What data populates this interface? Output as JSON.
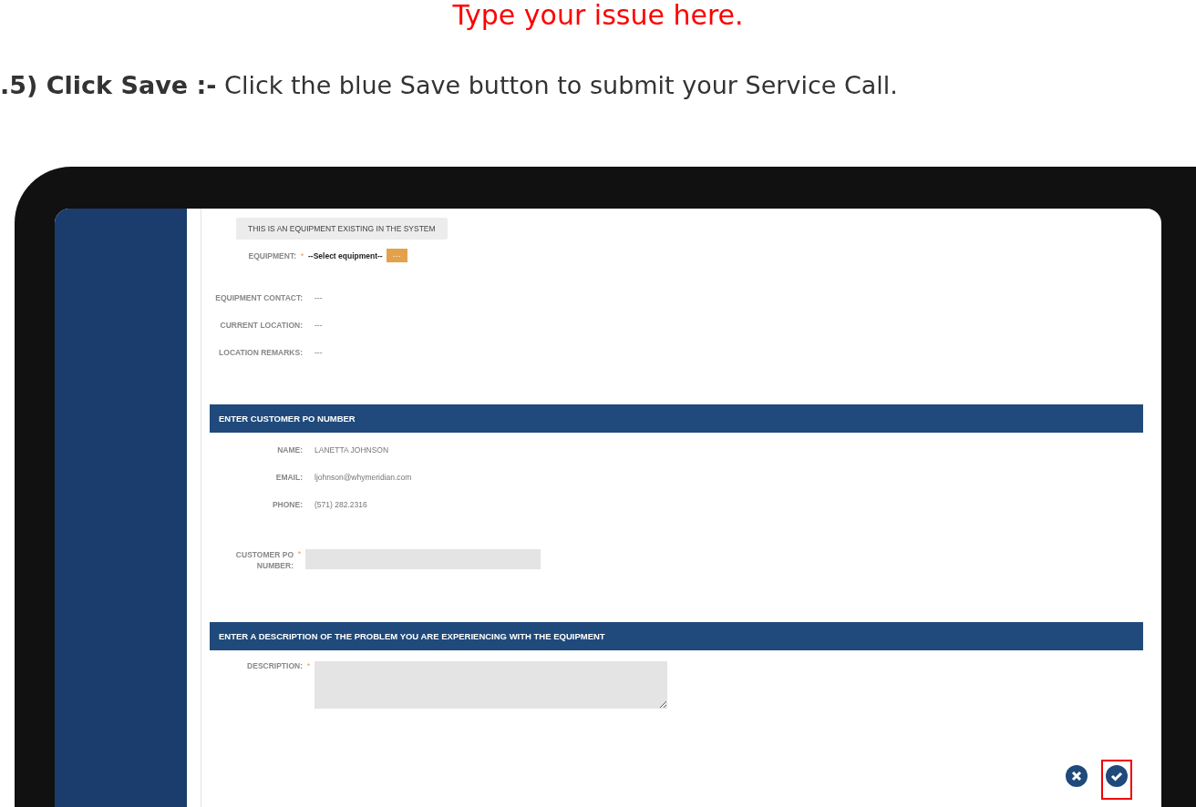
{
  "banner": {
    "text": "Type your issue here."
  },
  "instruction": {
    "text": "**.5) Click Save :-** Click the blue Save button to submit your Service Call."
  },
  "form": {
    "equipment_note": "THIS IS AN EQUIPMENT EXISTING IN THE SYSTEM",
    "equipment": {
      "label": "EQUIPMENT:",
      "required_mark": "*",
      "value": "--Select equipment--",
      "picker_button": "···"
    },
    "equipment_details": [
      {
        "label": "EQUIPMENT CONTACT:",
        "value": "---"
      },
      {
        "label": "CURRENT LOCATION:",
        "value": "---"
      },
      {
        "label": "LOCATION REMARKS:",
        "value": "---"
      }
    ],
    "po_section": {
      "title": "ENTER CUSTOMER PO NUMBER",
      "contact": [
        {
          "label": "NAME:",
          "value": "LANETTA JOHNSON"
        },
        {
          "label": "EMAIL:",
          "value": "ljohnson@whymeridian.com"
        },
        {
          "label": "PHONE:",
          "value": "(571) 282.2316"
        }
      ],
      "po_field": {
        "label": "CUSTOMER PO NUMBER:",
        "required_mark": "*"
      }
    },
    "description_section": {
      "title": "ENTER A DESCRIPTION OF THE PROBLEM YOU ARE EXPERIENCING WITH THE EQUIPMENT",
      "field": {
        "label": "DESCRIPTION:",
        "required_mark": "*"
      }
    },
    "actions": [
      {
        "kind": "cancel",
        "highlighted": false
      },
      {
        "kind": "save",
        "highlighted": true
      }
    ]
  }
}
